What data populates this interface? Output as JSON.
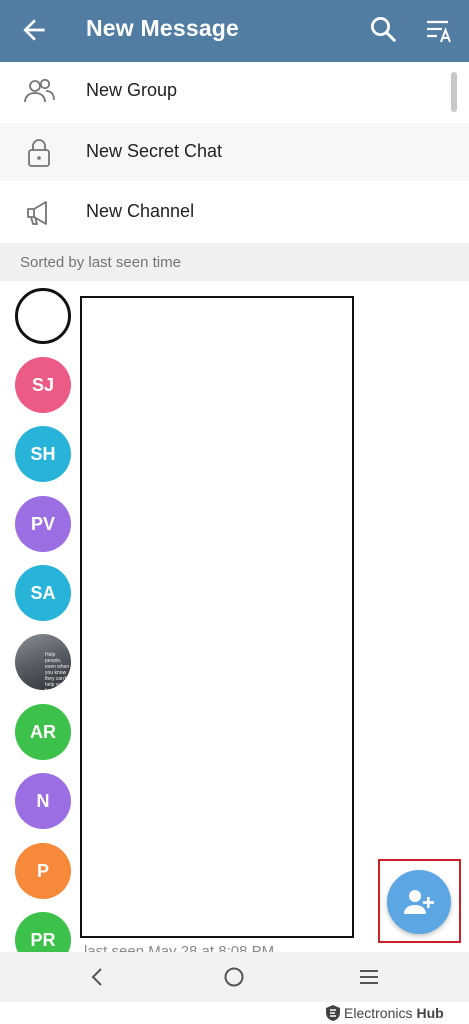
{
  "header": {
    "title": "New Message",
    "back_icon": "arrow-left-icon",
    "search_icon": "search-icon",
    "sort_icon": "sort-by-name-icon",
    "background": "#527da3"
  },
  "menu": [
    {
      "label": "New Group",
      "icon": "people-icon"
    },
    {
      "label": "New Secret Chat",
      "icon": "lock-icon"
    },
    {
      "label": "New Channel",
      "icon": "megaphone-icon"
    }
  ],
  "section_header": "Sorted by last seen time",
  "contacts": [
    {
      "initials": "",
      "color": "#ffffff"
    },
    {
      "initials": "SJ",
      "color": "#ec5b86"
    },
    {
      "initials": "SH",
      "color": "#28b4d8"
    },
    {
      "initials": "PV",
      "color": "#9b6ee3"
    },
    {
      "initials": "SA",
      "color": "#28b4d8"
    },
    {
      "initials": "",
      "photo_text": "Help people, even when you know they can't help you back",
      "color": "#5a5f66"
    },
    {
      "initials": "AR",
      "color": "#3cc24a"
    },
    {
      "initials": "N",
      "color": "#9b6ee3"
    },
    {
      "initials": "P",
      "color": "#f7893a"
    },
    {
      "initials": "PR",
      "color": "#3cc24a"
    }
  ],
  "partial_status": "last seen May 28 at 8:08 PM",
  "fab": {
    "icon": "add-contact-icon",
    "color": "#5ca7e3"
  },
  "navbar": {
    "back_icon": "nav-back-icon",
    "home_icon": "nav-home-icon",
    "recents_icon": "nav-recents-icon"
  },
  "watermark": {
    "brand": "Electronics",
    "suffix": "Hub"
  }
}
